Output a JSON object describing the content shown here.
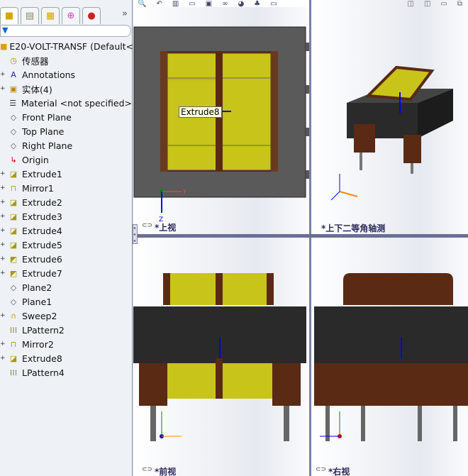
{
  "sidebar": {
    "tabs": [
      "feature-manager",
      "property-manager",
      "configuration-manager",
      "dimxpert",
      "display-manager"
    ],
    "more": "»",
    "filter_icon": "filter-icon",
    "items": [
      {
        "label": "E20-VOLT-TRANSF  (Default<",
        "icon": "part-icon",
        "expand": ""
      },
      {
        "label": "传感器",
        "icon": "sensor-folder-icon",
        "expand": ""
      },
      {
        "label": "Annotations",
        "icon": "annotations-folder-icon",
        "expand": "+"
      },
      {
        "label": "实体(4)",
        "icon": "solid-bodies-folder-icon",
        "expand": "+"
      },
      {
        "label": "Material <not specified>",
        "icon": "material-icon",
        "expand": ""
      },
      {
        "label": "Front Plane",
        "icon": "plane-icon",
        "expand": ""
      },
      {
        "label": "Top Plane",
        "icon": "plane-icon",
        "expand": ""
      },
      {
        "label": "Right Plane",
        "icon": "plane-icon",
        "expand": ""
      },
      {
        "label": "Origin",
        "icon": "origin-icon",
        "expand": ""
      },
      {
        "label": "Extrude1",
        "icon": "extrude-icon",
        "expand": "+"
      },
      {
        "label": "Mirror1",
        "icon": "mirror-icon",
        "expand": "+"
      },
      {
        "label": "Extrude2",
        "icon": "extrude-icon",
        "expand": "+"
      },
      {
        "label": "Extrude3",
        "icon": "extrude-icon",
        "expand": "+"
      },
      {
        "label": "Extrude4",
        "icon": "extrude-icon",
        "expand": "+"
      },
      {
        "label": "Extrude5",
        "icon": "extrude-icon",
        "expand": "+"
      },
      {
        "label": "Extrude6",
        "icon": "extrude-cut-icon",
        "expand": "+"
      },
      {
        "label": "Extrude7",
        "icon": "extrude-cut-icon",
        "expand": "+"
      },
      {
        "label": "Plane2",
        "icon": "plane-icon",
        "expand": ""
      },
      {
        "label": "Plane1",
        "icon": "plane-icon",
        "expand": ""
      },
      {
        "label": "Sweep2",
        "icon": "sweep-icon",
        "expand": "+"
      },
      {
        "label": "LPattern2",
        "icon": "linear-pattern-icon",
        "expand": ""
      },
      {
        "label": "Mirror2",
        "icon": "mirror-icon",
        "expand": "+"
      },
      {
        "label": "Extrude8",
        "icon": "extrude-icon",
        "expand": "+"
      },
      {
        "label": "LPattern4",
        "icon": "linear-pattern-icon",
        "expand": ""
      }
    ]
  },
  "viewports": {
    "top": "*上视",
    "iso": "*上下二等角轴测",
    "front": "*前视",
    "right": "*右视"
  },
  "tooltip": "Extrude8",
  "colors": {
    "coil": "#c8c41a",
    "bobbin": "#5a2a14",
    "core": "#2a2a2a",
    "accent": "#1a1aff"
  }
}
